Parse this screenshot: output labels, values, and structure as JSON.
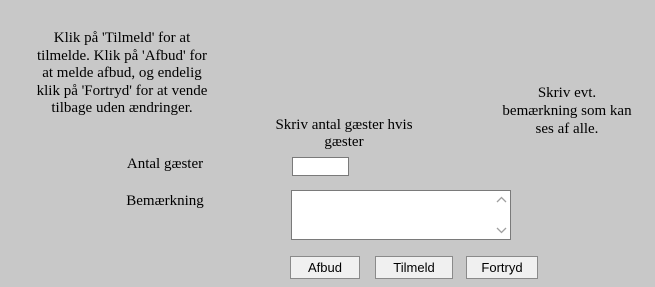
{
  "instructions": {
    "line1": "Klik på 'Tilmeld' for at",
    "line2": "tilmelde. Klik på 'Afbud' for",
    "line3": "at melde afbud, og endelig",
    "line4": "klik på 'Fortryd' for at vende",
    "line5": "tilbage uden ændringer."
  },
  "guest_hint": {
    "line1": "Skriv antal gæster hvis",
    "line2": "gæster"
  },
  "remark_hint": {
    "line1": "Skriv evt.",
    "line2": "bemærkning som kan",
    "line3": "ses af alle."
  },
  "form": {
    "guests_label": "Antal gæster",
    "guests_value": "",
    "remark_label": "Bemærkning",
    "remark_value": ""
  },
  "buttons": {
    "afbud": "Afbud",
    "tilmeld": "Tilmeld",
    "fortryd": "Fortryd"
  },
  "colors": {
    "panel_background": "#c8c8c8",
    "field_background": "#ffffff",
    "button_background": "#f0f0f0"
  },
  "icons": {
    "scroll_up": "chevron-up-icon",
    "scroll_down": "chevron-down-icon"
  }
}
